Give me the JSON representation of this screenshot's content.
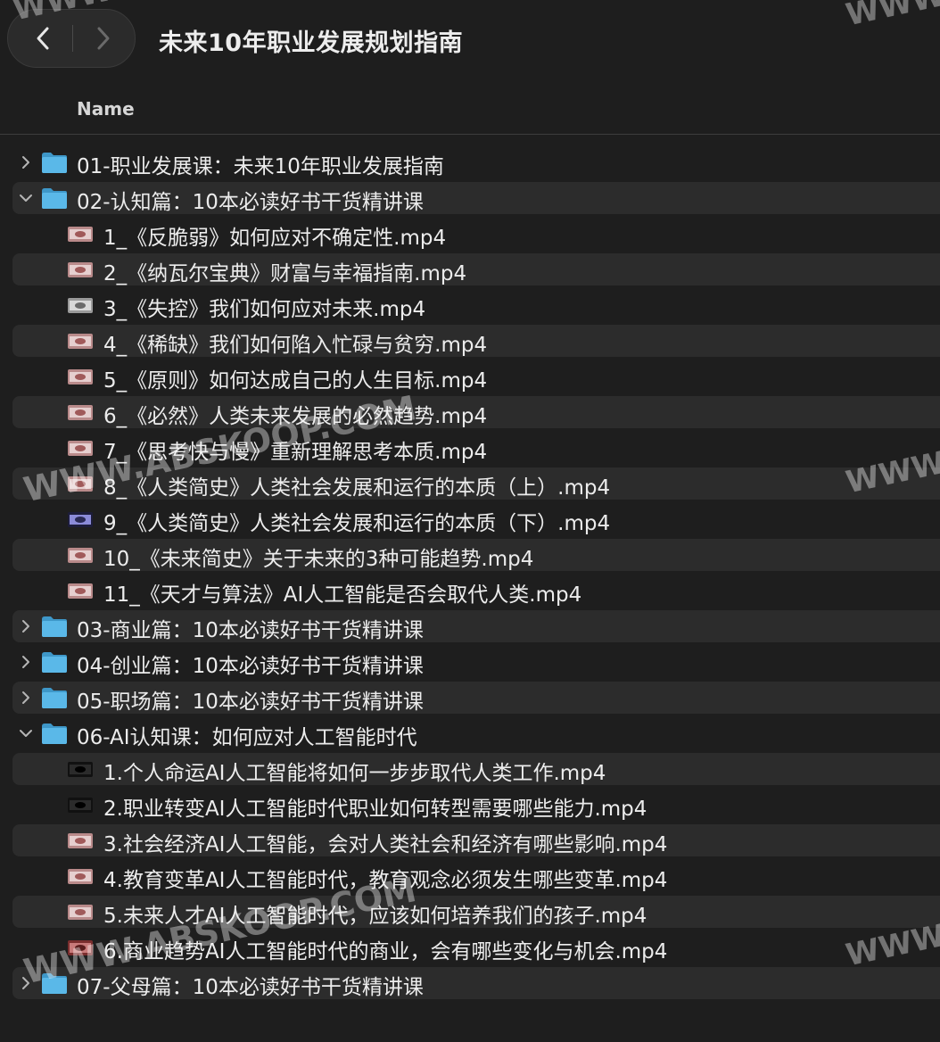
{
  "window": {
    "title": "未来10年职业发展规划指南",
    "back_icon": "chevron-left-icon",
    "forward_icon": "chevron-right-icon"
  },
  "columns": {
    "name": "Name"
  },
  "colors": {
    "folder_blue": "#5ab8e8",
    "background": "#1e1e1e",
    "row_alt": "#2c2c2c"
  },
  "items": [
    {
      "type": "folder",
      "expanded": false,
      "name": "01-职业发展课：未来10年职业发展指南"
    },
    {
      "type": "folder",
      "expanded": true,
      "name": "02-认知篇：10本必读好书干货精讲课"
    },
    {
      "type": "file",
      "thumb": "pink",
      "name": "1_《反脆弱》如何应对不确定性.mp4"
    },
    {
      "type": "file",
      "thumb": "pink",
      "name": "2_《纳瓦尔宝典》财富与幸福指南.mp4"
    },
    {
      "type": "file",
      "thumb": "gray",
      "name": "3_《失控》我们如何应对未来.mp4"
    },
    {
      "type": "file",
      "thumb": "pink",
      "name": "4_《稀缺》我们如何陷入忙碌与贫穷.mp4"
    },
    {
      "type": "file",
      "thumb": "pink",
      "name": "5_《原则》如何达成自己的人生目标.mp4"
    },
    {
      "type": "file",
      "thumb": "pink",
      "name": "6_《必然》人类未来发展的必然趋势.mp4"
    },
    {
      "type": "file",
      "thumb": "pink",
      "name": "7_《思考快与慢》重新理解思考本质.mp4"
    },
    {
      "type": "file",
      "thumb": "pink",
      "name": "8_《人类简史》人类社会发展和运行的本质（上）.mp4"
    },
    {
      "type": "file",
      "thumb": "dark",
      "name": "9_《人类简史》人类社会发展和运行的本质（下）.mp4"
    },
    {
      "type": "file",
      "thumb": "pink",
      "name": "10_《未来简史》关于未来的3种可能趋势.mp4"
    },
    {
      "type": "file",
      "thumb": "pink",
      "name": "11_《天才与算法》AI人工智能是否会取代人类.mp4"
    },
    {
      "type": "folder",
      "expanded": false,
      "name": "03-商业篇：10本必读好书干货精讲课"
    },
    {
      "type": "folder",
      "expanded": false,
      "name": "04-创业篇：10本必读好书干货精讲课"
    },
    {
      "type": "folder",
      "expanded": false,
      "name": "05-职场篇：10本必读好书干货精讲课"
    },
    {
      "type": "folder",
      "expanded": true,
      "name": "06-AI认知课：如何应对人工智能时代"
    },
    {
      "type": "file",
      "thumb": "black",
      "name": "1.个人命运AI人工智能将如何一步步取代人类工作.mp4"
    },
    {
      "type": "file",
      "thumb": "black",
      "name": "2.职业转变AI人工智能时代职业如何转型需要哪些能力.mp4"
    },
    {
      "type": "file",
      "thumb": "pink",
      "name": "3.社会经济AI人工智能，会对人类社会和经济有哪些影响.mp4"
    },
    {
      "type": "file",
      "thumb": "pink",
      "name": "4.教育变革AI人工智能时代，教育观念必须发生哪些变革.mp4"
    },
    {
      "type": "file",
      "thumb": "pink",
      "name": "5.未来人才AI人工智能时代，应该如何培养我们的孩子.mp4"
    },
    {
      "type": "file",
      "thumb": "red",
      "name": "6.商业趋势AI人工智能时代的商业，会有哪些变化与机会.mp4"
    },
    {
      "type": "folder",
      "expanded": false,
      "name": "07-父母篇：10本必读好书干货精讲课"
    }
  ],
  "watermarks": [
    "WWW",
    "WWW",
    "WWW.ABSKOOP.COM",
    "WWW",
    "WWW.ABSKOOP.COM",
    "WWW"
  ]
}
